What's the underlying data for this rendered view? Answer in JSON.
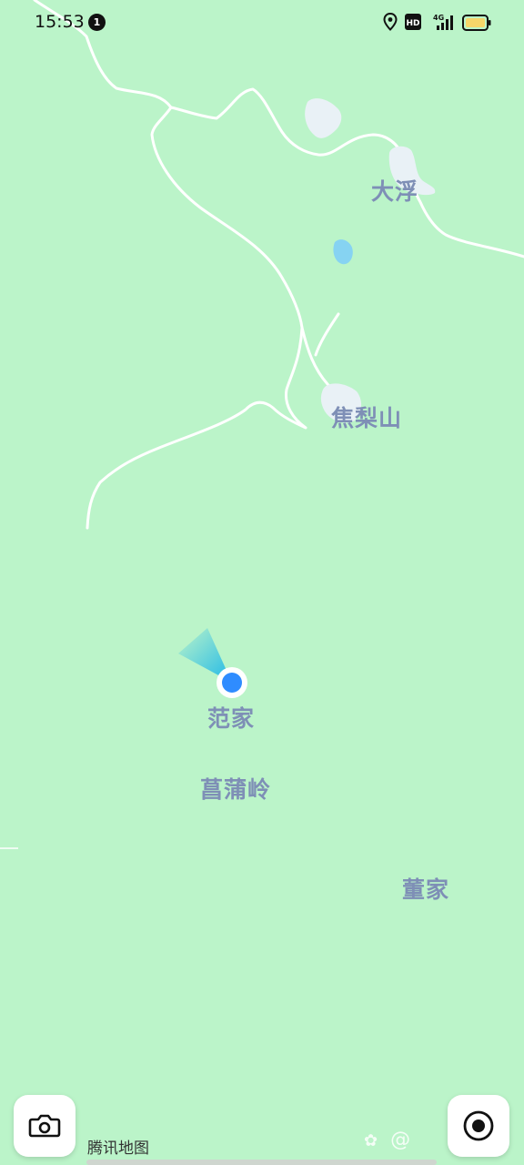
{
  "status_bar": {
    "time": "15:53",
    "notification_count": "1",
    "icons": [
      "location-icon",
      "hd-icon",
      "signal-4g-icon",
      "battery-icon"
    ],
    "network": "4G"
  },
  "map": {
    "background_color": "#bbf4c9",
    "road_color": "#ffffff",
    "water_color": "#86d3f2",
    "places": {
      "dafu": "大浮",
      "jiaolishan": "焦梨山",
      "fanjia": "范家",
      "changpuling": "菖蒲岭",
      "dongjia": "董家"
    }
  },
  "location_marker": {
    "color": "#2f8cff"
  },
  "controls": {
    "camera_icon": "camera-icon",
    "locate_icon": "target-icon"
  },
  "attribution": {
    "text": "腾讯地图",
    "extra": "@"
  }
}
